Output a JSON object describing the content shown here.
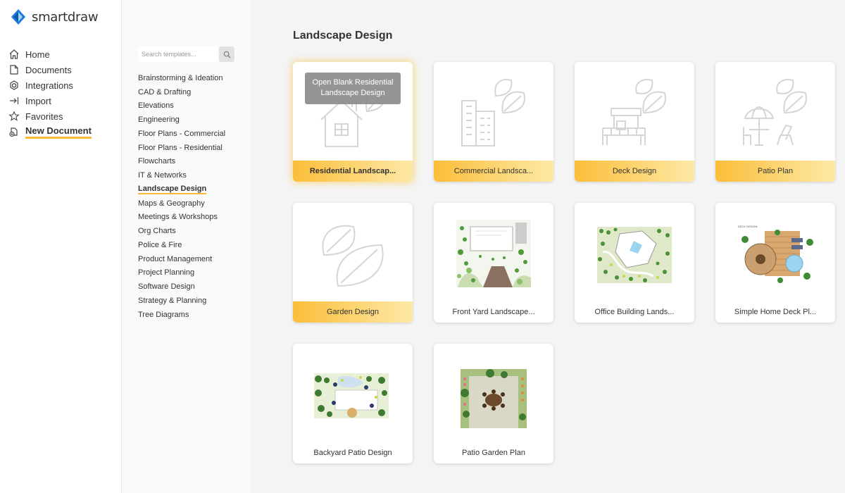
{
  "app": {
    "logo_text": "smartdraw"
  },
  "leftnav": {
    "items": [
      {
        "label": "Home",
        "icon": "home-icon"
      },
      {
        "label": "Documents",
        "icon": "documents-icon"
      },
      {
        "label": "Integrations",
        "icon": "integrations-icon"
      },
      {
        "label": "Import",
        "icon": "import-icon"
      },
      {
        "label": "Favorites",
        "icon": "star-icon"
      },
      {
        "label": "New Document",
        "icon": "new-document-icon",
        "active": true
      }
    ]
  },
  "search": {
    "placeholder": "Search templates..."
  },
  "categories": [
    "Brainstorming & Ideation",
    "CAD & Drafting",
    "Elevations",
    "Engineering",
    "Floor Plans - Commercial",
    "Floor Plans - Residential",
    "Flowcharts",
    "IT & Networks",
    "Landscape Design",
    "Maps & Geography",
    "Meetings & Workshops",
    "Org Charts",
    "Police & Fire",
    "Product Management",
    "Project Planning",
    "Software Design",
    "Strategy & Planning",
    "Tree Diagrams"
  ],
  "active_category": "Landscape Design",
  "main": {
    "title": "Landscape Design",
    "tooltip": "Open Blank Residential Landscape Design",
    "templates": [
      {
        "label": "Residential Landscap...",
        "kind": "blank",
        "icon": "house-leaf-icon"
      },
      {
        "label": "Commercial Landsca...",
        "kind": "blank",
        "icon": "building-leaf-icon"
      },
      {
        "label": "Deck Design",
        "kind": "blank",
        "icon": "deck-leaf-icon"
      },
      {
        "label": "Patio Plan",
        "kind": "blank",
        "icon": "patio-leaf-icon"
      },
      {
        "label": "Garden Design",
        "kind": "blank",
        "icon": "leaf-icon"
      },
      {
        "label": "Front Yard Landscape...",
        "kind": "example",
        "icon": "front-yard-plan-thumbnail"
      },
      {
        "label": "Office Building Lands...",
        "kind": "example",
        "icon": "office-landscape-thumbnail"
      },
      {
        "label": "Simple Home Deck Pl...",
        "kind": "example",
        "icon": "home-deck-thumbnail",
        "caption": "DECK DESIGN"
      },
      {
        "label": "Backyard Patio Design",
        "kind": "example",
        "icon": "backyard-patio-thumbnail"
      },
      {
        "label": "Patio Garden Plan",
        "kind": "example",
        "icon": "patio-garden-thumbnail"
      }
    ]
  },
  "colors": {
    "accent": "#fcb831",
    "logo_blue": "#1f7bd6"
  }
}
